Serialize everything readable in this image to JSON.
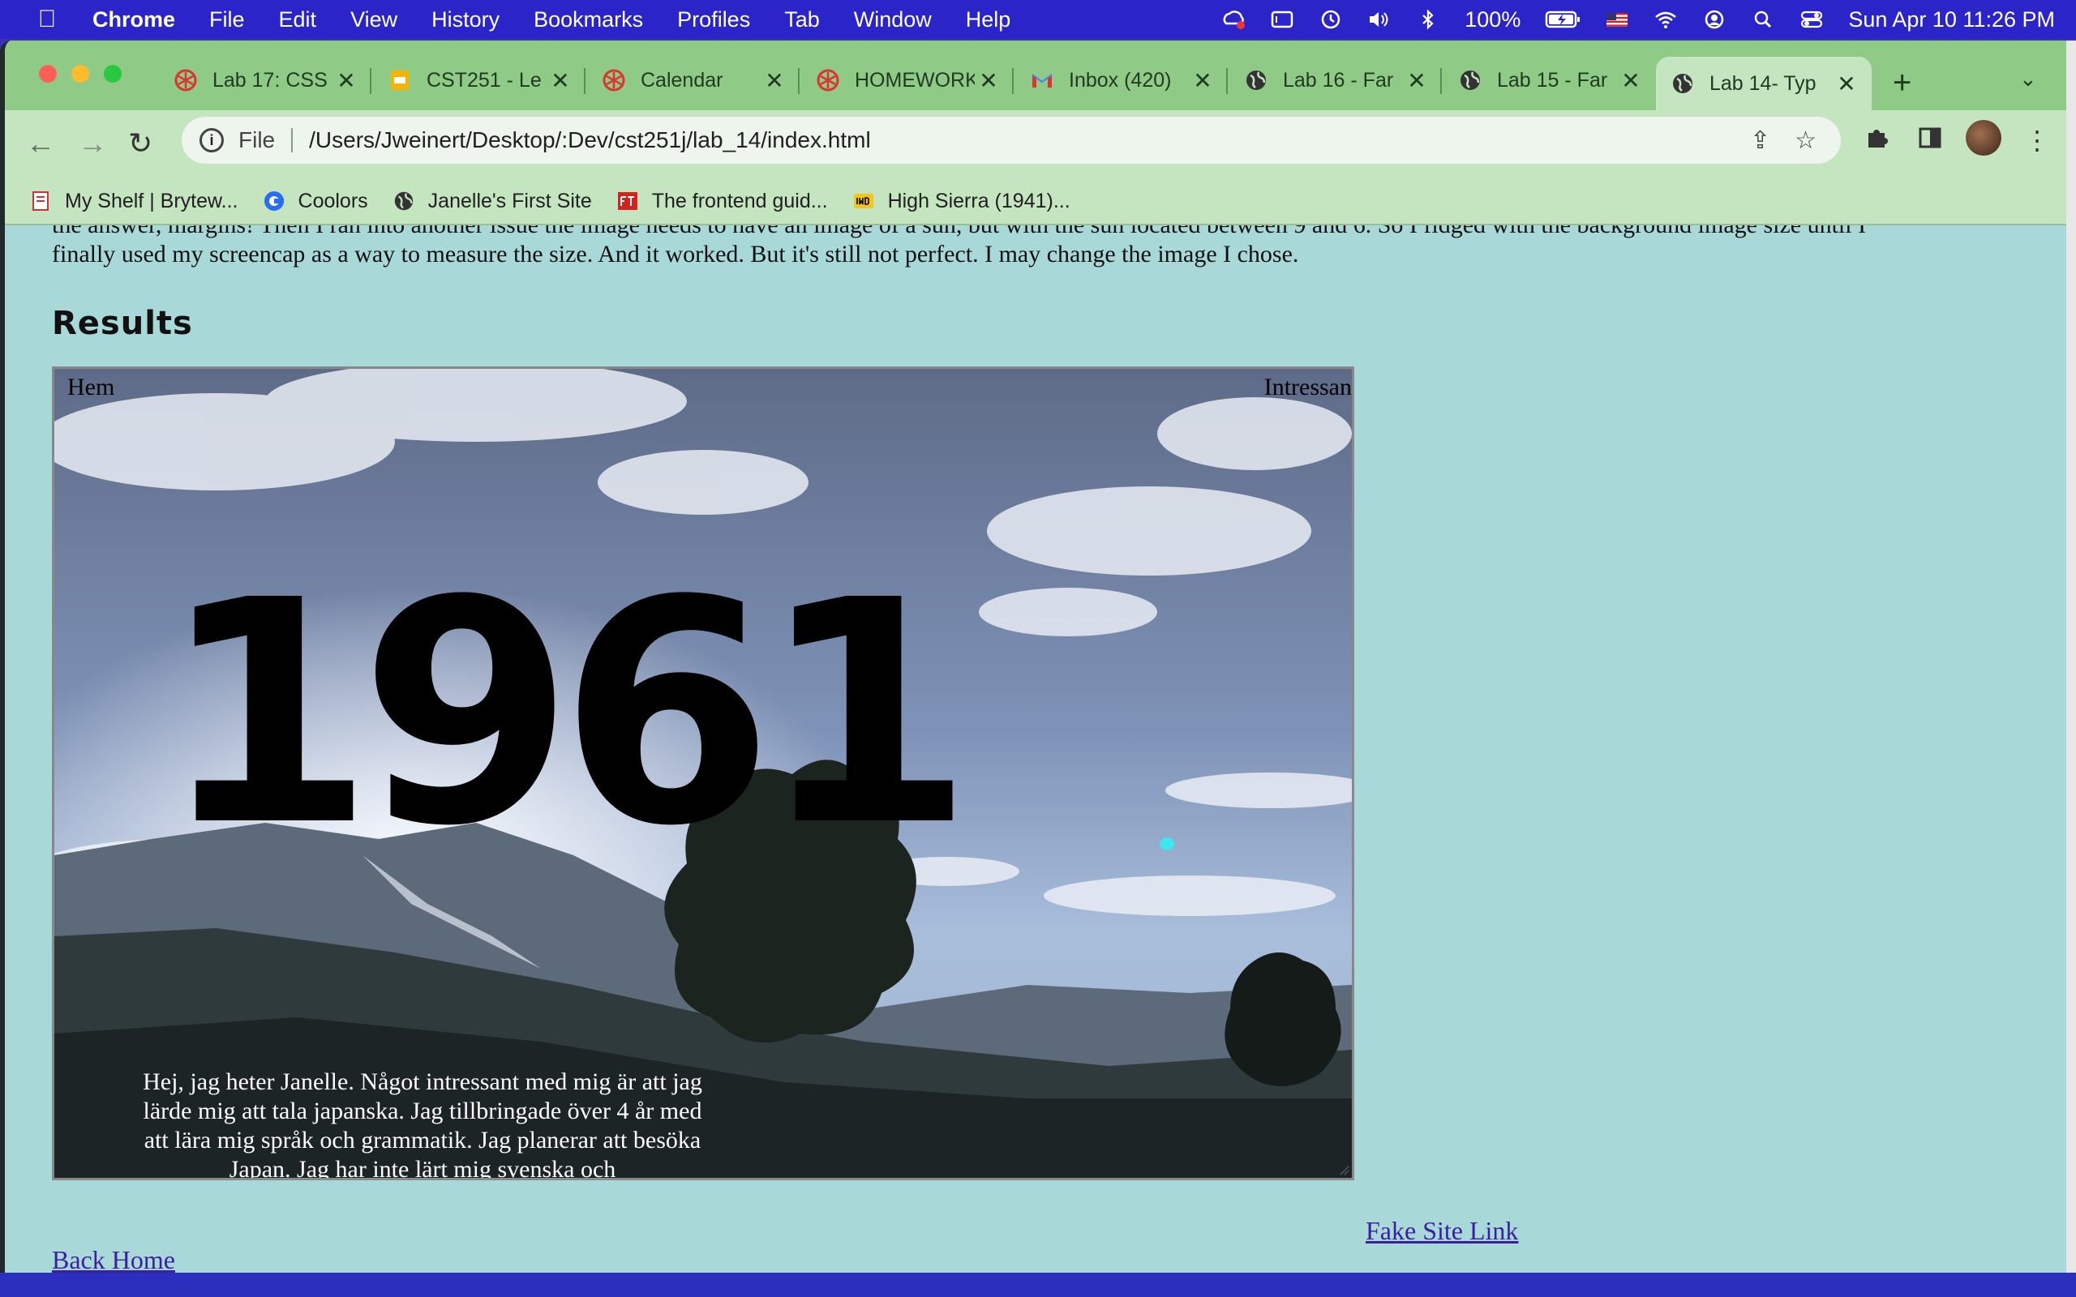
{
  "menubar": {
    "items": [
      "Chrome",
      "File",
      "Edit",
      "View",
      "History",
      "Bookmarks",
      "Profiles",
      "Tab",
      "Window",
      "Help"
    ],
    "battery": "100%",
    "datetime": "Sun Apr 10  11:26 PM"
  },
  "tabs": [
    {
      "title": "Lab 17: CSS",
      "icon": "asterisk-icon"
    },
    {
      "title": "CST251 - Le",
      "icon": "slides-icon"
    },
    {
      "title": "Calendar",
      "icon": "asterisk-icon"
    },
    {
      "title": "HOMEWORK",
      "icon": "asterisk-icon"
    },
    {
      "title": "Inbox (420)",
      "icon": "gmail-icon"
    },
    {
      "title": "Lab 16 - Far",
      "icon": "globe-icon"
    },
    {
      "title": "Lab 15 - Far",
      "icon": "globe-icon"
    },
    {
      "title": "Lab 14- Typ",
      "icon": "globe-icon"
    }
  ],
  "toolbar": {
    "scheme": "File",
    "url": "/Users/Jweinert/Desktop/:Dev/cst251j/lab_14/index.html"
  },
  "bookmarks": [
    {
      "label": "My Shelf | Brytew...",
      "icon": "book-icon"
    },
    {
      "label": "Coolors",
      "icon": "coolors-icon"
    },
    {
      "label": "Janelle's First Site",
      "icon": "globe-icon"
    },
    {
      "label": "The frontend guid...",
      "icon": "ftf-icon"
    },
    {
      "label": "High Sierra (1941)...",
      "icon": "imdb-icon"
    }
  ],
  "page": {
    "para_line1": "the answer, margins! Then I ran into another issue the image needs to have an image of a sun, but with the sun located between 9 and 6. So I fidged with the background image size until I",
    "para_line2": "finally used my screencap as a way to measure the size. And it worked. But it's still not perfect. I may change the image I chose.",
    "results_heading": "Results",
    "nav_left": "Hem",
    "nav_right": "Intressan",
    "year": "1961",
    "bio": "Hej, jag heter Janelle. Något intressant med mig är att jag lärde mig att tala japanska. Jag tillbringade över 4 år med att lära mig språk och grammatik. Jag planerar att besöka Japan. Jag har inte lärt mig svenska och",
    "fake_link": "Fake Site Link",
    "back_link": "Back Home"
  }
}
